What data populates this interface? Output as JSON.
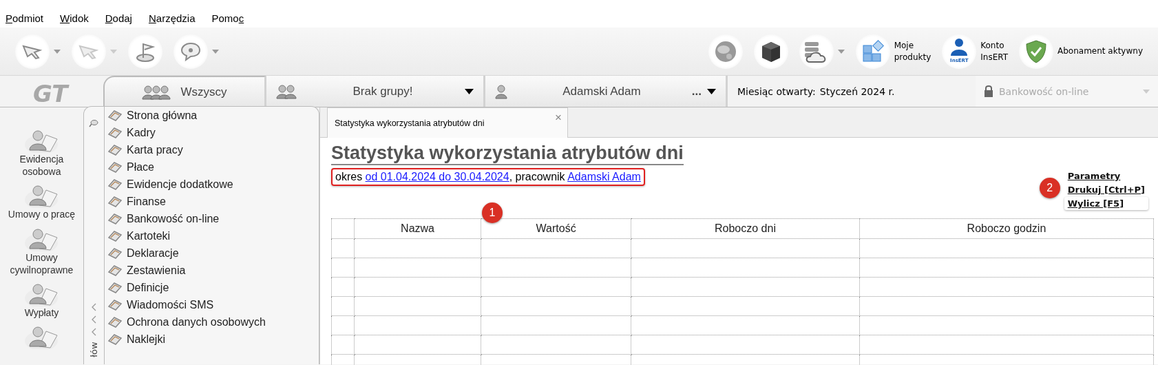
{
  "menu": [
    {
      "key": "P",
      "after": "odmiot"
    },
    {
      "key": "W",
      "after": "idok"
    },
    {
      "key": "D",
      "after": "odaj"
    },
    {
      "key": "N",
      "after": "arzędzia"
    },
    {
      "before": "Pomo",
      "key": "c"
    }
  ],
  "toolbar": {
    "left": [
      {
        "kind": "arrow",
        "dropdown": true,
        "disabled": false
      },
      {
        "kind": "arrow",
        "dropdown": true,
        "disabled": true
      },
      {
        "kind": "flag",
        "dropdown": false,
        "disabled": false
      },
      {
        "kind": "help",
        "dropdown": true,
        "disabled": false
      }
    ],
    "right": [
      {
        "kind": "globe"
      },
      {
        "kind": "cube"
      },
      {
        "kind": "cloud",
        "dropdown": true
      },
      {
        "kind": "tiles",
        "label": "Moje\nprodukty"
      },
      {
        "kind": "account",
        "label": "Konto\nInsERT",
        "icon_text": "InsERT"
      },
      {
        "kind": "shield",
        "label": "Abonament aktywny"
      }
    ]
  },
  "logo": "GT",
  "context_bar": {
    "group_all": {
      "label": "Wszyscy",
      "selected": true
    },
    "group": {
      "label": "Brak grupy!"
    },
    "employee": {
      "label": "Adamski Adam",
      "more": "..."
    },
    "month": {
      "label": "Miesiąc otwarty:",
      "value": "Styczeń 2024 r."
    },
    "banking": {
      "label": "Bankowość on-line",
      "disabled": true
    }
  },
  "rail": [
    {
      "label": "Ewidencja\nosobowa"
    },
    {
      "label": "Umowy o pracę"
    },
    {
      "label": "Umowy\ncywilnoprawne"
    },
    {
      "label": "Wypłaty"
    }
  ],
  "nav": {
    "strip_label": "łów",
    "items": [
      {
        "label": "Strona główna"
      },
      {
        "label": "Kadry"
      },
      {
        "label": "Karta pracy"
      },
      {
        "label": "Płace"
      },
      {
        "label": "Ewidencje dodatkowe"
      },
      {
        "label": "Finanse"
      },
      {
        "label": "Bankowość on-line"
      },
      {
        "label": "Kartoteki"
      },
      {
        "label": "Deklaracje"
      },
      {
        "label": "Zestawienia"
      },
      {
        "label": "Definicje"
      },
      {
        "label": "Wiadomości SMS"
      },
      {
        "label": "Ochrona danych osobowych"
      },
      {
        "label": "Naklejki"
      }
    ]
  },
  "document_tab": {
    "label": "Statystyka wykorzystania atrybutów dni",
    "close": "×"
  },
  "report": {
    "title": "Statystyka wykorzystania atrybutów dni",
    "subtitle": {
      "highlighted": true,
      "prefix": "okres ",
      "period": "od 01.04.2024 do 30.04.2024",
      "middle": ", pracownik ",
      "employee": "Adamski Adam"
    },
    "actions": [
      {
        "label": "Parametry",
        "highlighted": false
      },
      {
        "label": "Drukuj [Ctrl+P]",
        "highlighted": false
      },
      {
        "label": "Wylicz [F5]",
        "highlighted": true
      }
    ],
    "badges": [
      "1",
      "2"
    ],
    "table": {
      "columns": [
        "Nazwa",
        "Wartość",
        "Roboczo dni",
        "Roboczo godzin"
      ]
    }
  }
}
